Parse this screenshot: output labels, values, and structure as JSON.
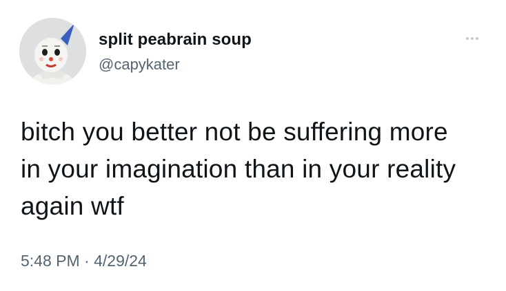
{
  "author": {
    "display_name": "split peabrain soup",
    "handle": "@capykater",
    "avatar_icon": "clown-doll-avatar"
  },
  "menu": {
    "icon": "more-options-icon"
  },
  "tweet": {
    "lines": [
      "bitch you better not be suffering more",
      "in your imagination than in your reality",
      "again wtf"
    ],
    "time": "5:48 PM",
    "separator": "·",
    "date": "4/29/24"
  },
  "colors": {
    "text": "#0f1419",
    "secondary": "#536471",
    "background": "#ffffff"
  }
}
